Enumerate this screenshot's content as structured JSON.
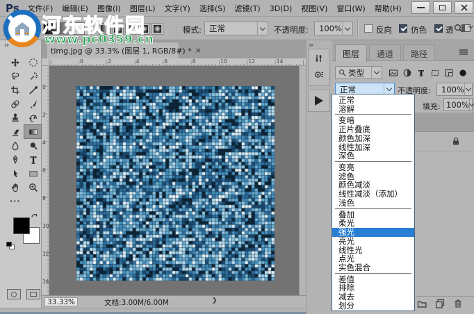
{
  "window": {
    "logo": "Ps"
  },
  "menu": {
    "items": [
      "文件(F)",
      "编辑(E)",
      "图像(I)",
      "图层(L)",
      "文字(Y)",
      "选择(S)",
      "滤镜(T)",
      "3D(D)",
      "视图(V)",
      "窗口(W)",
      "帮助(H)"
    ]
  },
  "options": {
    "mode_label": "模式:",
    "mode_value": "正常",
    "opacity_label": "不透明度:",
    "opacity_value": "100%",
    "reverse": {
      "label": "反向",
      "checked": false
    },
    "dither": {
      "label": "仿色",
      "checked": true
    },
    "transparency": {
      "label": "透",
      "checked": true
    },
    "gradient_types": [
      "linear-gradient",
      "radial-gradient",
      "angle-gradient",
      "reflected-gradient",
      "diamond-gradient"
    ]
  },
  "watermark": {
    "title": "河东软件园",
    "url": "www.pc0359.cn",
    "title_color": "#2a64d9",
    "url_color": "#1fa34c"
  },
  "doc_tab": {
    "title": "timg.jpg @ 33.3% (图层 1, RGB/8#) *",
    "close": "×"
  },
  "rulers": {
    "h": [
      "0",
      "2",
      "4",
      "6",
      "8",
      "10",
      "12",
      "14"
    ],
    "v": [
      "0",
      "2",
      "4",
      "6",
      "8",
      "10",
      "12",
      "14"
    ]
  },
  "status": {
    "zoom": "33.33%",
    "doc": "文档:3.00M/6.00M",
    "arrow": "❯"
  },
  "tools": {
    "names": [
      "move",
      "marquee",
      "lasso",
      "magic-wand",
      "crop",
      "eyedropper",
      "healing-brush",
      "brush",
      "clone-stamp",
      "history-brush",
      "eraser",
      "gradient",
      "blur",
      "dodge",
      "pen",
      "type",
      "path-select",
      "rectangle",
      "hand",
      "zoom"
    ],
    "selected": "gradient",
    "more_label": "···"
  },
  "panel": {
    "tabs": [
      "图层",
      "通道",
      "路径"
    ],
    "active": "图层",
    "filter_label": "类型",
    "filter_icons": [
      "pixel-filter",
      "adjustment-filter",
      "type-filter",
      "shape-filter",
      "smart-object-filter",
      "filter-toggle"
    ],
    "blend_value": "正常",
    "opacity_label": "不透明度:",
    "opacity_value": "100%",
    "fill_label": "填充:",
    "fill_value": "100%",
    "bottom_icons": [
      "folder",
      "new-layer",
      "delete"
    ]
  },
  "blend_menu": {
    "selected": "强光",
    "groups": [
      [
        "正常",
        "溶解"
      ],
      [
        "变暗",
        "正片叠底",
        "颜色加深",
        "线性加深",
        "深色"
      ],
      [
        "变亮",
        "滤色",
        "颜色减淡",
        "线性减淡（添加）",
        "浅色"
      ],
      [
        "叠加",
        "柔光",
        "强光",
        "亮光",
        "线性光",
        "点光",
        "实色混合"
      ],
      [
        "差值",
        "排除",
        "减去",
        "划分"
      ]
    ]
  },
  "mosaic": {
    "cols": 60,
    "rows": 59,
    "seed": 12,
    "palette": [
      "#0d2334",
      "#1c4a6e",
      "#2e6f9e",
      "#4690bd",
      "#69aed3",
      "#92c8e4",
      "#bfe2f2",
      "#e8f6fc"
    ]
  },
  "colors": {
    "selection_blue": "#2a7fd4",
    "canvas_bg": "#737373"
  }
}
